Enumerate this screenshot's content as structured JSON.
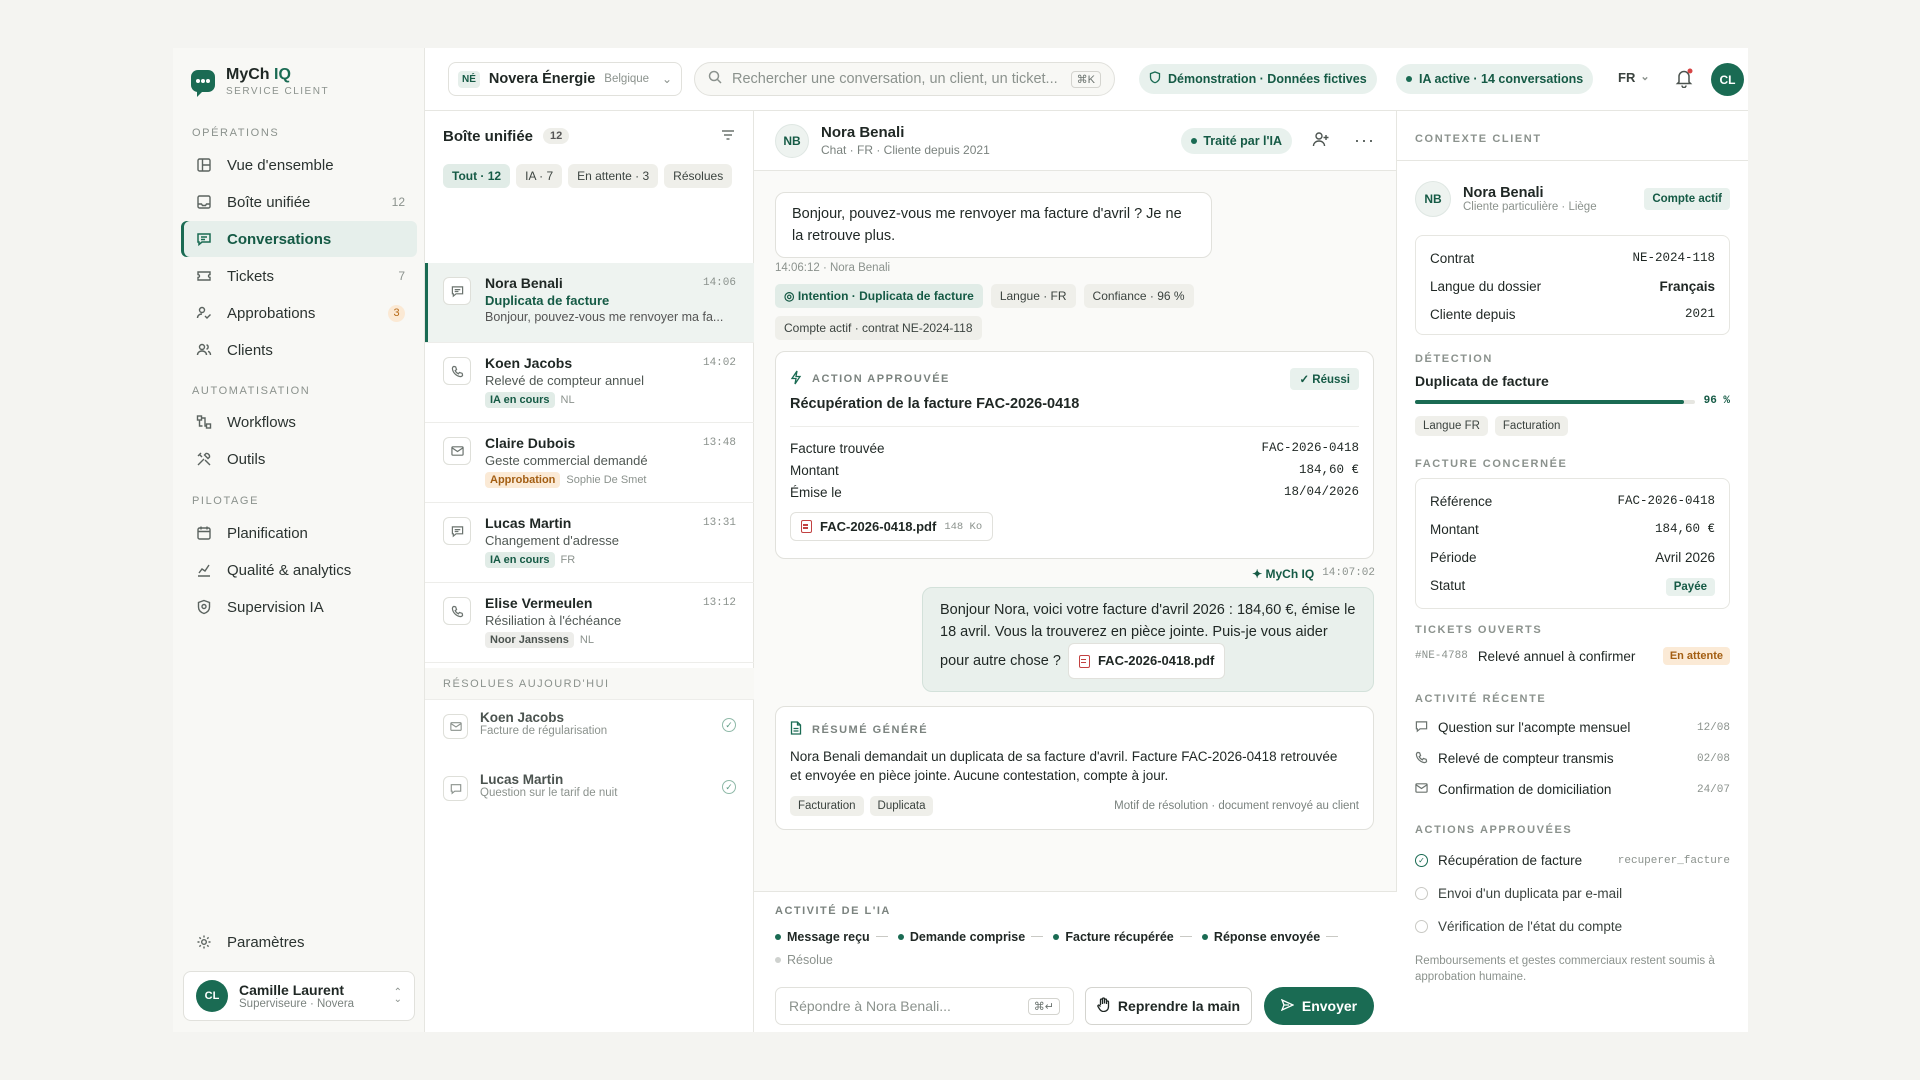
{
  "app": {
    "name_a": "MyCh",
    "name_b": "IQ",
    "subtitle": "SERVICE CLIENT"
  },
  "sidebar": {
    "sections": [
      "OPÉRATIONS",
      "AUTOMATISATION",
      "PILOTAGE"
    ],
    "items": [
      {
        "label": "Vue d'ensemble",
        "icon": "dashboard-icon",
        "count": ""
      },
      {
        "label": "Boîte unifiée",
        "icon": "inbox-icon",
        "count": "12"
      },
      {
        "label": "Conversations",
        "icon": "chat-icon",
        "count": ""
      },
      {
        "label": "Tickets",
        "icon": "ticket-icon",
        "count": "7"
      },
      {
        "label": "Approbations",
        "icon": "approval-icon",
        "count": "3"
      },
      {
        "label": "Clients",
        "icon": "users-icon",
        "count": ""
      },
      {
        "label": "Workflows",
        "icon": "workflow-icon",
        "count": ""
      },
      {
        "label": "Outils",
        "icon": "tools-icon",
        "count": ""
      },
      {
        "label": "Planification",
        "icon": "calendar-icon",
        "count": ""
      },
      {
        "label": "Qualité & analytics",
        "icon": "chart-icon",
        "count": ""
      },
      {
        "label": "Supervision IA",
        "icon": "shield-icon",
        "count": ""
      }
    ],
    "settings": "Paramètres",
    "user": {
      "initials": "CL",
      "name": "Camille Laurent",
      "role": "Superviseure · Novera"
    }
  },
  "topbar": {
    "org_tag": "NÉ",
    "org_name": "Novera Énergie",
    "org_country": "Belgique",
    "search_placeholder": "Rechercher une conversation, un client, un ticket...",
    "search_kbd": "⌘K",
    "demo_pill": "Démonstration · Données fictives",
    "ai_pill": "IA active · 14 conversations",
    "lang": "FR",
    "user_initials": "CL"
  },
  "inbox": {
    "title": "Boîte unifiée",
    "count": "12",
    "filters": [
      "Tout · 12",
      "IA · 7",
      "En attente · 3",
      "Résolues"
    ],
    "conversations": [
      {
        "name": "Nora Benali",
        "time": "14:06",
        "subject": "Duplicata de facture",
        "preview": "Bonjour, pouvez-vous me renvoyer ma fa..."
      },
      {
        "name": "Koen Jacobs",
        "time": "14:02",
        "subject": "Relevé de compteur annuel",
        "tag": "IA en cours",
        "lang": "NL"
      },
      {
        "name": "Claire Dubois",
        "time": "13:48",
        "subject": "Geste commercial demandé",
        "tag": "Approbation",
        "agent": "Sophie De Smet"
      },
      {
        "name": "Lucas Martin",
        "time": "13:31",
        "subject": "Changement d'adresse",
        "tag": "IA en cours",
        "lang": "FR"
      },
      {
        "name": "Elise Vermeulen",
        "time": "13:12",
        "subject": "Résiliation à l'échéance",
        "tag": "Noor Janssens",
        "lang": "NL"
      }
    ],
    "resolved_title": "RÉSOLUES AUJOURD'HUI",
    "resolved": [
      {
        "name": "Koen Jacobs",
        "subject": "Facture de régularisation"
      },
      {
        "name": "Lucas Martin",
        "subject": "Question sur le tarif de nuit"
      }
    ]
  },
  "conversation": {
    "initials": "NB",
    "name": "Nora Benali",
    "meta": "Chat · FR · Cliente depuis 2021",
    "status": "Traité par l'IA",
    "customer_message": "Bonjour, pouvez-vous me renvoyer ma facture d'avril ? Je ne la retrouve plus.",
    "customer_meta": "14:06:12 · Nora Benali",
    "intents": [
      "Intention · Duplicata de facture",
      "Langue · FR",
      "Confiance · 96 %",
      "Compte actif · contrat NE-2024-118"
    ],
    "action": {
      "label": "ACTION APPROUVÉE",
      "status": "Réussi",
      "title": "Récupération de la facture FAC-2026-0418",
      "rows": [
        {
          "k": "Facture trouvée",
          "v": "FAC-2026-0418"
        },
        {
          "k": "Montant",
          "v": "184,60 €"
        },
        {
          "k": "Émise le",
          "v": "18/04/2026"
        }
      ],
      "file": "FAC-2026-0418.pdf",
      "file_size": "148 Ko"
    },
    "bot_sender": "✦ MyCh IQ",
    "bot_time": "14:07:02",
    "bot_message": "Bonjour Nora, voici votre facture d'avril 2026 : 184,60 €, émise le 18 avril. Vous la trouverez en pièce jointe. Puis-je vous aider pour autre chose ?",
    "bot_file": "FAC-2026-0418.pdf",
    "summary": {
      "label": "RÉSUMÉ GÉNÉRÉ",
      "text": "Nora Benali demandait un duplicata de sa facture d'avril. Facture FAC-2026-0418 retrouvée et envoyée en pièce jointe. Aucune contestation, compte à jour.",
      "tags": [
        "Facturation",
        "Duplicata"
      ],
      "reason": "Motif de résolution · document renvoyé au client"
    },
    "activity": {
      "label": "ACTIVITÉ DE L'IA",
      "steps": [
        "Message reçu",
        "Demande comprise",
        "Facture récupérée",
        "Réponse envoyée",
        "Résolue"
      ]
    },
    "reply_placeholder": "Répondre à Nora Benali...",
    "take_over": "Reprendre la main",
    "send": "Envoyer"
  },
  "context": {
    "title": "CONTEXTE CLIENT",
    "initials": "NB",
    "name": "Nora Benali",
    "sub": "Cliente particulière · Liège",
    "status": "Compte actif",
    "contract": [
      {
        "k": "Contrat",
        "v": "NE-2024-118"
      },
      {
        "k": "Langue du dossier",
        "v": "Français"
      },
      {
        "k": "Cliente depuis",
        "v": "2021"
      }
    ],
    "detection_label": "DÉTECTION",
    "detection": "Duplicata de facture",
    "confidence": "96 %",
    "confidence_value": 0.96,
    "detection_tags": [
      "Langue FR",
      "Facturation"
    ],
    "invoice_label": "FACTURE CONCERNÉE",
    "invoice": [
      {
        "k": "Référence",
        "v": "FAC-2026-0418"
      },
      {
        "k": "Montant",
        "v": "184,60 €"
      },
      {
        "k": "Période",
        "v": "Avril 2026"
      },
      {
        "k": "Statut",
        "v": "Payée"
      }
    ],
    "tickets_label": "TICKETS OUVERTS",
    "ticket": {
      "id": "#NE-4788",
      "title": "Relevé annuel à confirmer",
      "status": "En attente"
    },
    "activity_label": "ACTIVITÉ RÉCENTE",
    "activity": [
      {
        "label": "Question sur l'acompte mensuel",
        "date": "12/08"
      },
      {
        "label": "Relevé de compteur transmis",
        "date": "02/08"
      },
      {
        "label": "Confirmation de domiciliation",
        "date": "24/07"
      }
    ],
    "actions_label": "ACTIONS APPROUVÉES",
    "actions": [
      {
        "label": "Récupération de facture",
        "code": "recuperer_facture"
      },
      {
        "label": "Envoi d'un duplicata par e-mail",
        "code": ""
      },
      {
        "label": "Vérification de l'état du compte",
        "code": ""
      }
    ],
    "footnote": "Remboursements et gestes commerciaux restent soumis à approbation humaine."
  },
  "colors": {
    "accent": "#1a6b53",
    "amber": "#b76a17",
    "pdf_red": "#c24141"
  }
}
